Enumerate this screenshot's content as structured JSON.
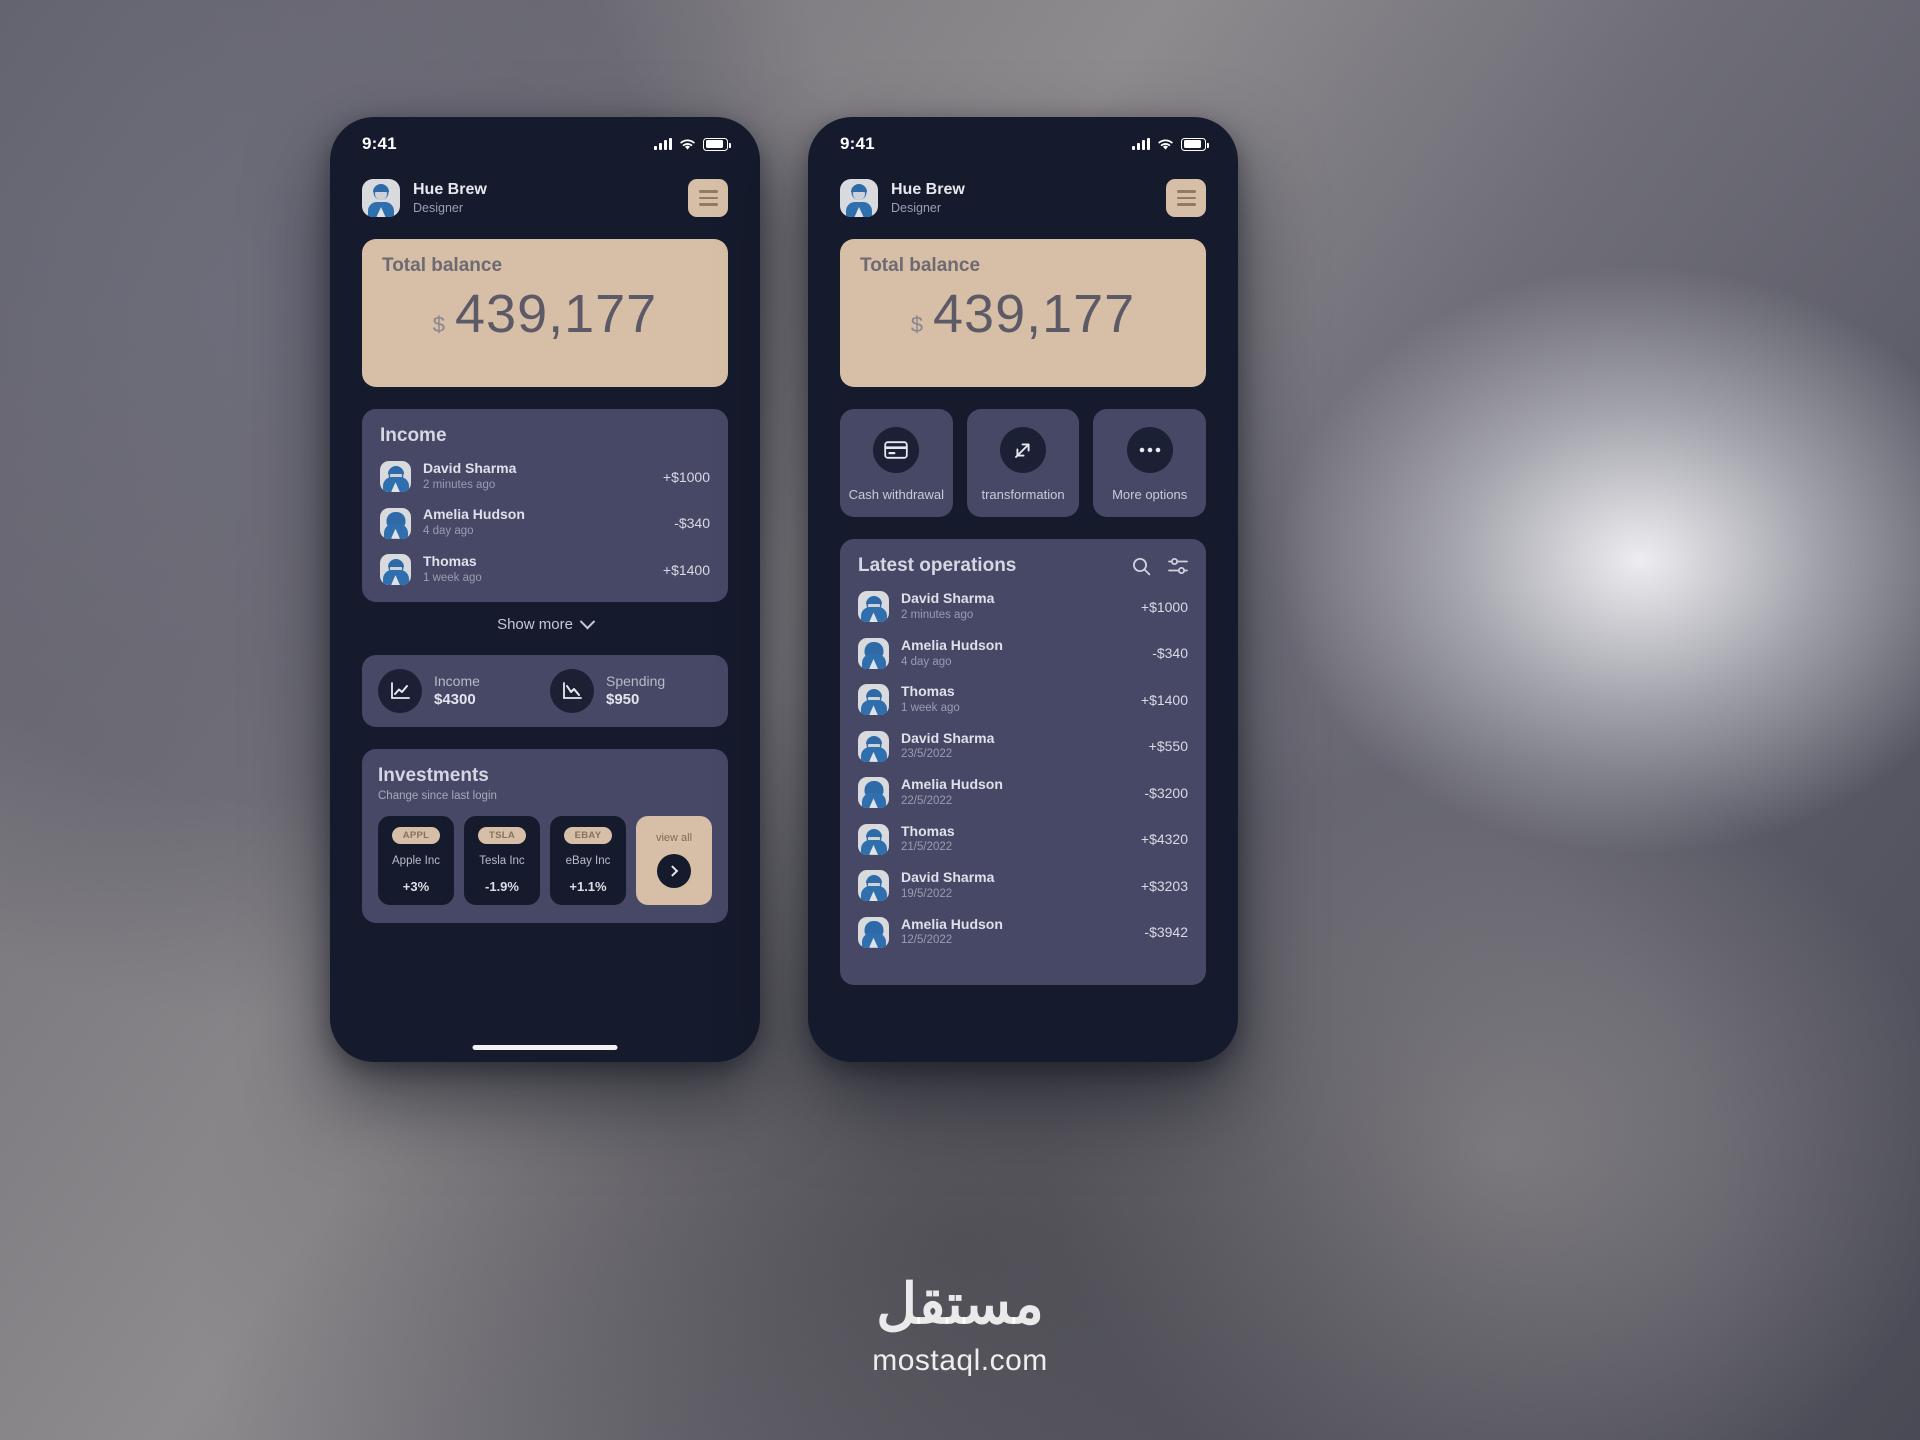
{
  "statusbar": {
    "time": "9:41",
    "signal_icon": "signal-bars-icon",
    "wifi_icon": "wifi-icon",
    "battery_icon": "battery-icon"
  },
  "header": {
    "name": "Hue Brew",
    "role": "Designer",
    "avatar_icon": "user-avatar-icon",
    "menu_icon": "hamburger-menu-icon"
  },
  "balance": {
    "label": "Total balance",
    "currency": "$",
    "value": "439,177"
  },
  "income": {
    "title": "Income",
    "items": [
      {
        "name": "David Sharma",
        "time": "2 minutes ago",
        "amount": "+$1000",
        "avatar": "male-avatar-icon"
      },
      {
        "name": "Amelia Hudson",
        "time": "4 day ago",
        "amount": "-$340",
        "avatar": "female-avatar-icon"
      },
      {
        "name": "Thomas",
        "time": "1 week ago",
        "amount": "+$1400",
        "avatar": "male-avatar-icon"
      }
    ],
    "show_more": "Show more",
    "show_more_icon": "chevron-down-icon"
  },
  "stats": [
    {
      "label": "Income",
      "value": "$4300",
      "icon": "line-chart-up-icon"
    },
    {
      "label": "Spending",
      "value": "$950",
      "icon": "line-chart-down-icon"
    }
  ],
  "investments": {
    "title": "Investments",
    "subtitle": "Change since last login",
    "items": [
      {
        "ticker": "APPL",
        "name": "Apple Inc",
        "change": "+3%"
      },
      {
        "ticker": "TSLA",
        "name": "Tesla Inc",
        "change": "-1.9%"
      },
      {
        "ticker": "EBAY",
        "name": "eBay Inc",
        "change": "+1.1%"
      }
    ],
    "view_all": "view all",
    "view_all_icon": "chevron-right-icon"
  },
  "actions": [
    {
      "label": "Cash withdrawal",
      "icon": "card-icon"
    },
    {
      "label": "transformation",
      "icon": "transfer-arrows-icon"
    },
    {
      "label": "More options",
      "icon": "ellipsis-icon"
    }
  ],
  "operations": {
    "title": "Latest operations",
    "search_icon": "search-icon",
    "filter_icon": "filter-sliders-icon",
    "items": [
      {
        "name": "David Sharma",
        "time": "2 minutes ago",
        "amount": "+$1000",
        "avatar": "male-avatar-icon"
      },
      {
        "name": "Amelia Hudson",
        "time": "4 day ago",
        "amount": "-$340",
        "avatar": "female-avatar-icon"
      },
      {
        "name": "Thomas",
        "time": "1 week ago",
        "amount": "+$1400",
        "avatar": "male-avatar-icon"
      },
      {
        "name": "David Sharma",
        "time": "23/5/2022",
        "amount": "+$550",
        "avatar": "male-avatar-icon"
      },
      {
        "name": "Amelia Hudson",
        "time": "22/5/2022",
        "amount": "-$3200",
        "avatar": "female-avatar-icon"
      },
      {
        "name": "Thomas",
        "time": "21/5/2022",
        "amount": "+$4320",
        "avatar": "male-avatar-icon"
      },
      {
        "name": "David Sharma",
        "time": "19/5/2022",
        "amount": "+$3203",
        "avatar": "male-avatar-icon"
      },
      {
        "name": "Amelia Hudson",
        "time": "12/5/2022",
        "amount": "-$3942",
        "avatar": "female-avatar-icon"
      }
    ]
  },
  "watermark": {
    "arabic": "مستقل",
    "latin": "mostaql.com"
  },
  "colors": {
    "accent": "#d6bfa6",
    "card": "#464866",
    "screen": "#151a2c",
    "text": "#e7e8ee"
  }
}
